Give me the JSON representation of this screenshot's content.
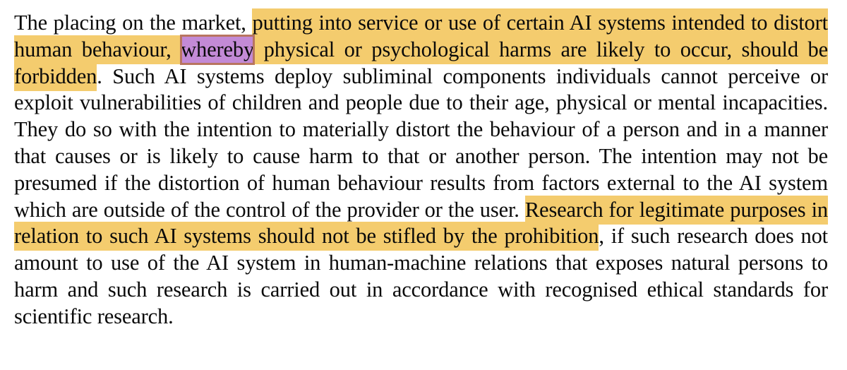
{
  "document": {
    "colors": {
      "highlight_yellow": "#f4cc6e",
      "highlight_purple": "#c38ad6",
      "highlight_purple_border": "#b87560",
      "text": "#0a0a0a",
      "background": "#ffffff"
    },
    "segments": [
      {
        "text": "The placing on the market, ",
        "highlight": "none"
      },
      {
        "text": "putting into service or use of certain AI systems intended to distort human behaviour, ",
        "highlight": "yellow"
      },
      {
        "text": "whereby",
        "highlight": "purple"
      },
      {
        "text": " physical or psychological harms are likely to occur, should be forbidden",
        "highlight": "yellow"
      },
      {
        "text": ". Such AI systems deploy subliminal components individuals cannot perceive or exploit vulnerabilities of children and people due to their age, physical or mental incapacities. They do so with the intention to materially distort the behaviour of a person and in a manner that causes or is likely to cause harm to that or another person. The intention may not be presumed if the distortion of human behaviour results from factors external to the AI system which are outside of the control of the provider or the user. ",
        "highlight": "none"
      },
      {
        "text": "Research for legitimate purposes in relation to such AI systems should not be stifled by the prohibition",
        "highlight": "yellow"
      },
      {
        "text": ", if such research does not amount to use of the AI system in human-machine relations that exposes natural persons to harm and such research is carried out in accordance with recognised ethical standards for scientific research.",
        "highlight": "none"
      }
    ]
  }
}
